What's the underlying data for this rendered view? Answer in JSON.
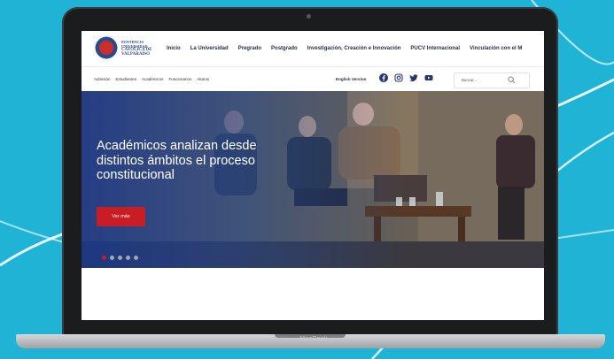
{
  "device": {
    "brand_label": "MacBook"
  },
  "logo": {
    "line1": "PONTIFICIA",
    "line2": "UNIVERSIDAD",
    "line3": "CATÓLICA DE",
    "line4": "VALPARAÍSO"
  },
  "main_nav": [
    "Inicio",
    "La Universidad",
    "Pregrado",
    "Postgrado",
    "Investigación, Creación e Innovación",
    "PUCV Internacional",
    "Vinculación con el M"
  ],
  "sub_nav": [
    "Admisión",
    "Estudiantes",
    "Académicos",
    "Funcionarios",
    "Alumni"
  ],
  "language_link": "English Version",
  "social_icons": [
    "facebook-icon",
    "instagram-icon",
    "twitter-icon",
    "youtube-icon"
  ],
  "search": {
    "placeholder": "Buscar..."
  },
  "hero": {
    "title": "Académicos analizan desde distintos ámbitos el proceso constitucional",
    "button": "Ver más",
    "slides": 5,
    "active_slide": 1
  },
  "colors": {
    "accent_red": "#c81d25",
    "brand_blue": "#26356b",
    "background": "#1fb3d6"
  }
}
